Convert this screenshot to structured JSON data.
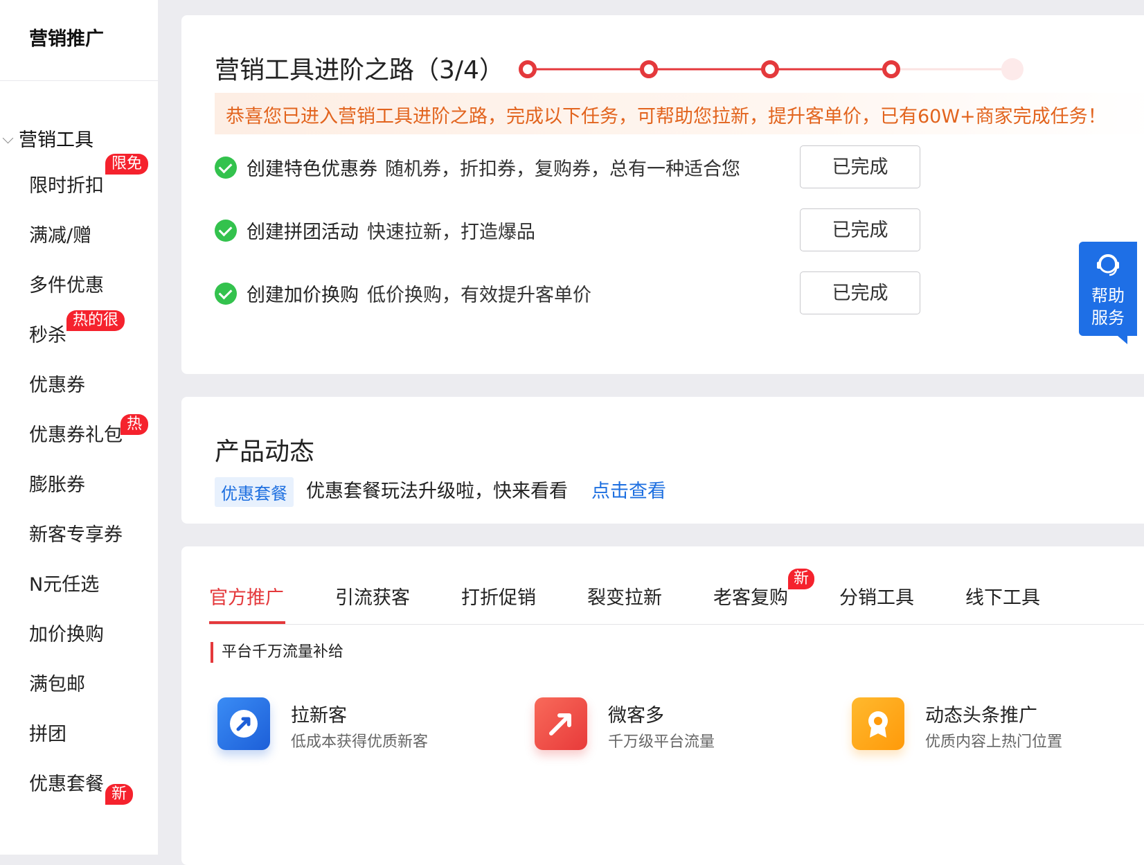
{
  "sidebar": {
    "title": "营销推广",
    "group": "营销工具",
    "items": [
      {
        "label": "限时折扣",
        "badge": "限免"
      },
      {
        "label": "满减/赠",
        "badge": ""
      },
      {
        "label": "多件优惠",
        "badge": ""
      },
      {
        "label": "秒杀",
        "badge": "热的很"
      },
      {
        "label": "优惠券",
        "badge": ""
      },
      {
        "label": "优惠券礼包",
        "badge": "热"
      },
      {
        "label": "膨胀券",
        "badge": ""
      },
      {
        "label": "新客专享券",
        "badge": ""
      },
      {
        "label": "N元任选",
        "badge": ""
      },
      {
        "label": "加价换购",
        "badge": ""
      },
      {
        "label": "满包邮",
        "badge": ""
      },
      {
        "label": "拼团",
        "badge": ""
      },
      {
        "label": "优惠套餐",
        "badge": "新"
      }
    ]
  },
  "roadmap": {
    "title": "营销工具进阶之路（3/4）",
    "progress": {
      "completed": 4,
      "total": 5
    },
    "banner": "恭喜您已进入营销工具进阶之路，完成以下任务，可帮助您拉新，提升客单价，已有60W+商家完成任务！",
    "tasks": [
      {
        "name": "创建特色优惠券",
        "desc": "随机券，折扣券，复购券，总有一种适合您",
        "button": "已完成"
      },
      {
        "name": "创建拼团活动",
        "desc": "快速拉新，打造爆品",
        "button": "已完成"
      },
      {
        "name": "创建加价换购",
        "desc": "低价换购，有效提升客单价",
        "button": "已完成"
      }
    ]
  },
  "news": {
    "title": "产品动态",
    "tag": "优惠套餐",
    "text": "优惠套餐玩法升级啦，快来看看",
    "link": "点击查看"
  },
  "tools": {
    "tabs": [
      "官方推广",
      "引流获客",
      "打折促销",
      "裂变拉新",
      "老客复购",
      "分销工具",
      "线下工具"
    ],
    "new_badge": "新",
    "section": "平台千万流量补给",
    "features": [
      {
        "name": "拉新客",
        "desc": "低成本获得优质新客",
        "icon": "compass-arrow-icon"
      },
      {
        "name": "微客多",
        "desc": "千万级平台流量",
        "icon": "trend-arrow-icon"
      },
      {
        "name": "动态头条推广",
        "desc": "优质内容上热门位置",
        "icon": "award-ribbon-icon"
      }
    ]
  },
  "help": {
    "label": "帮助服务"
  },
  "colors": {
    "brand_red": "#e4393c",
    "link_blue": "#1d6fe0",
    "success_green": "#33c24d",
    "banner_orange": "#e2641e",
    "help_blue": "#1e6fe6"
  }
}
